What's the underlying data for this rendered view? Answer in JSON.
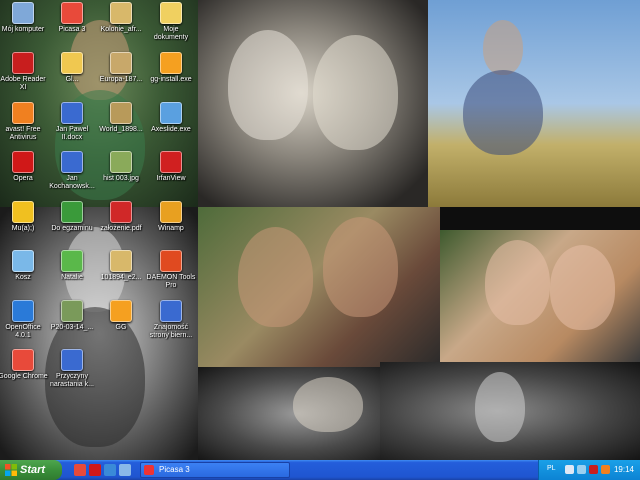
{
  "desktop": {
    "icons": [
      {
        "label": "Mój komputer",
        "icon": "computer-icon",
        "color": "#7fa8d8"
      },
      {
        "label": "Picasa 3",
        "icon": "picasa-icon",
        "color": "#e84a3a"
      },
      {
        "label": "Kolonie_afr...",
        "icon": "image-file-icon",
        "color": "#d8b86a"
      },
      {
        "label": "Moje\ndokumenty",
        "icon": "documents-folder-icon",
        "color": "#f0d060"
      },
      {
        "label": "Adobe Reader\nXI",
        "icon": "adobe-reader-icon",
        "color": "#c81e1e"
      },
      {
        "label": "Gl...",
        "icon": "folder-icon",
        "color": "#f0c850"
      },
      {
        "label": "Europa-187...",
        "icon": "image-file-icon",
        "color": "#c8a86a"
      },
      {
        "label": "gg-install.exe",
        "icon": "gg-installer-icon",
        "color": "#f5a020"
      },
      {
        "label": "avast! Free\nAntivirus",
        "icon": "avast-icon",
        "color": "#f08020"
      },
      {
        "label": "Jan Pawel\nII.docx",
        "icon": "word-document-icon",
        "color": "#3a6ad0"
      },
      {
        "label": "World_1898...",
        "icon": "image-file-icon",
        "color": "#b89a5a"
      },
      {
        "label": "Axeslide.exe",
        "icon": "axeslide-icon",
        "color": "#5aa0e0"
      },
      {
        "label": "Opera",
        "icon": "opera-icon",
        "color": "#d01818"
      },
      {
        "label": "Jan\nKochanowsk...",
        "icon": "word-document-icon",
        "color": "#3a6ad0"
      },
      {
        "label": "hist 003.jpg",
        "icon": "image-file-icon",
        "color": "#8aaa5a"
      },
      {
        "label": "IrfanView",
        "icon": "irfanview-icon",
        "color": "#d02020"
      },
      {
        "label": "Mu(a);)",
        "icon": "star-icon",
        "color": "#f0c020"
      },
      {
        "label": "Do egzaminu",
        "icon": "tree-icon",
        "color": "#3a9a3a"
      },
      {
        "label": "założenie.pdf",
        "icon": "pdf-file-icon",
        "color": "#d02828"
      },
      {
        "label": "Winamp",
        "icon": "winamp-icon",
        "color": "#e8a020"
      },
      {
        "label": "Kosz",
        "icon": "recycle-bin-icon",
        "color": "#7ab8e8"
      },
      {
        "label": "Natalie",
        "icon": "colorful-file-icon",
        "color": "#5ab84a"
      },
      {
        "label": "101894_e2...",
        "icon": "image-file-icon",
        "color": "#d8b86a"
      },
      {
        "label": "DAEMON Tools\nPro",
        "icon": "daemon-tools-icon",
        "color": "#e04a20"
      },
      {
        "label": "OpenOffice\n4.0.1",
        "icon": "openoffice-icon",
        "color": "#2a7ad8"
      },
      {
        "label": "P20-03-14_...",
        "icon": "image-file-icon",
        "color": "#7a9a5a"
      },
      {
        "label": "GG",
        "icon": "gg-icon",
        "color": "#f5a020"
      },
      {
        "label": "Znajomość\nstrony biern...",
        "icon": "word-document-icon",
        "color": "#3a6ad0"
      },
      {
        "label": "Google Chrome",
        "icon": "chrome-icon",
        "color": "#e84a3a"
      },
      {
        "label": "Przyczyny\nnarastania k...",
        "icon": "word-document-icon",
        "color": "#3a6ad0"
      }
    ]
  },
  "taskbar": {
    "start_label": "Start",
    "quick_launch": [
      {
        "icon": "chrome-icon",
        "color": "#e84a3a"
      },
      {
        "icon": "opera-icon",
        "color": "#d01818"
      },
      {
        "icon": "media-icon",
        "color": "#3a8ad8"
      },
      {
        "icon": "show-desktop-icon",
        "color": "#8ab8e8"
      }
    ],
    "active_window": {
      "label": "Picasa 3",
      "icon": "picasa-icon"
    },
    "tray": {
      "language": "PL",
      "icons": [
        {
          "icon": "keyboard-icon",
          "color": "#dfe8f5"
        },
        {
          "icon": "network-icon",
          "color": "#9ad0f0"
        },
        {
          "icon": "adobe-tray-icon",
          "color": "#c81e1e"
        },
        {
          "icon": "avast-tray-icon",
          "color": "#f08020"
        }
      ],
      "clock": "19:14"
    }
  }
}
